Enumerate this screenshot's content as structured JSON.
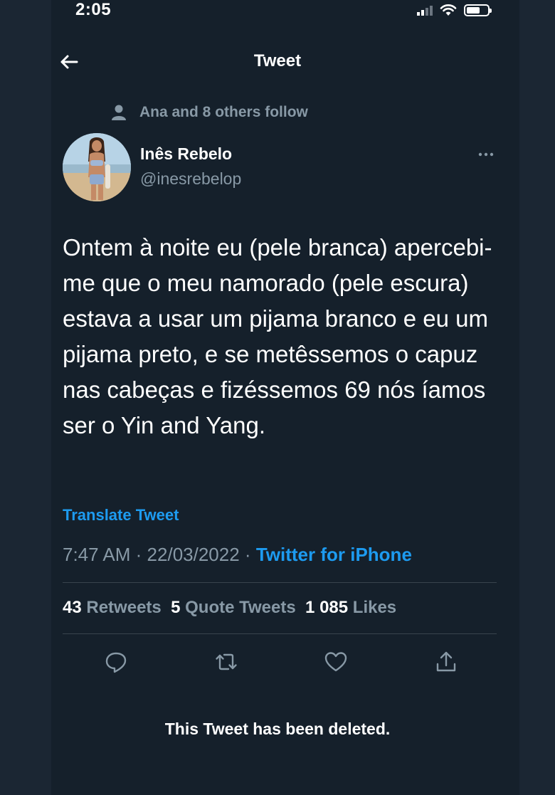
{
  "status_bar": {
    "time": "2:05",
    "signal_icon": "cellular-signal-icon",
    "wifi_icon": "wifi-icon",
    "battery_icon": "battery-icon"
  },
  "header": {
    "back_icon": "back-arrow-icon",
    "title": "Tweet"
  },
  "social_context": {
    "icon": "person-icon",
    "text": "Ana and 8 others follow"
  },
  "author": {
    "name": "Inês Rebelo",
    "handle": "@inesrebelop",
    "more_icon": "more-options-icon"
  },
  "tweet": {
    "text": "Ontem à noite eu (pele branca) apercebi-me que o meu namorado (pele escura) estava a usar um pijama branco e eu um pijama preto, e se metêssemos o capuz nas cabeças e fizéssemos 69 nós íamos ser o Yin and Yang.",
    "translate_label": "Translate Tweet",
    "time": "7:47 AM",
    "date": "22/03/2022",
    "separator": "·",
    "source": "Twitter for iPhone"
  },
  "stats": {
    "retweets_count": "43",
    "retweets_label": "Retweets",
    "quotes_count": "5",
    "quotes_label": "Quote Tweets",
    "likes_count": "1 085",
    "likes_label": "Likes"
  },
  "actions": [
    {
      "name": "reply",
      "icon": "reply-icon"
    },
    {
      "name": "retweet",
      "icon": "retweet-icon"
    },
    {
      "name": "like",
      "icon": "heart-icon"
    },
    {
      "name": "share",
      "icon": "share-icon"
    }
  ],
  "notice": {
    "text": "This Tweet has been deleted."
  },
  "colors": {
    "background": "#15202b",
    "accent": "#1d9bf0",
    "secondary_text": "#8899a6",
    "divider": "#38444d"
  }
}
